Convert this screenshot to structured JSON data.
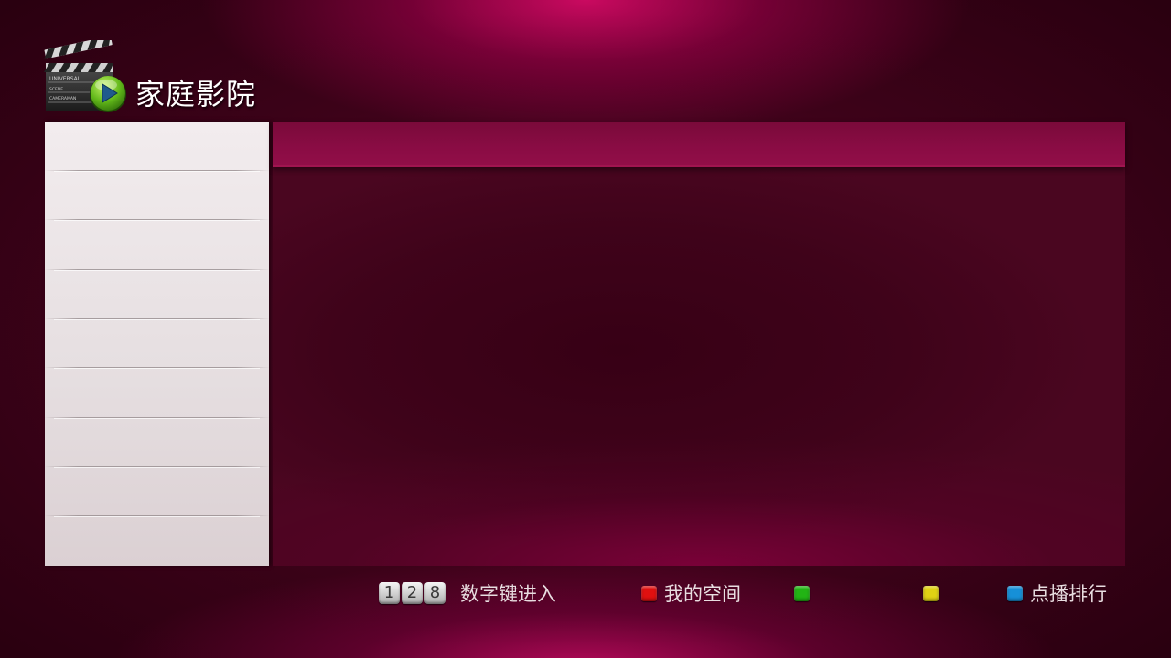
{
  "app": {
    "title": "家庭影院",
    "logo": {
      "icon": "clapperboard-play-icon",
      "lines": [
        "UNIVERSAL",
        "SCENE",
        "CAMERAMAN"
      ]
    }
  },
  "sidebar": {
    "items": [
      "",
      "",
      "",
      "",
      "",
      "",
      "",
      "",
      ""
    ]
  },
  "main": {
    "header_text": ""
  },
  "footer": {
    "number_keys": [
      "1",
      "2",
      "8"
    ],
    "number_hint": "数字键进入",
    "color_keys": [
      {
        "color": "#e01010",
        "label": "我的空间",
        "icon": "red-key-icon"
      },
      {
        "color": "#22b414",
        "label": "",
        "icon": "green-key-icon"
      },
      {
        "color": "#e0d214",
        "label": "",
        "icon": "yellow-key-icon"
      },
      {
        "color": "#1690d8",
        "label": "点播排行",
        "icon": "blue-key-icon"
      }
    ]
  }
}
